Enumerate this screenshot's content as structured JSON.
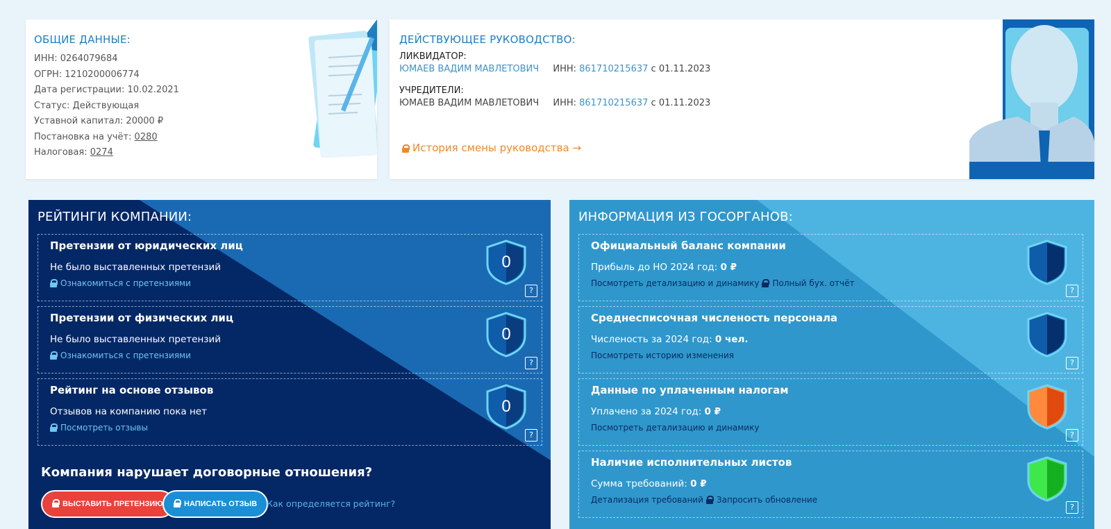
{
  "general": {
    "title": "ОБЩИЕ ДАННЫЕ:",
    "inn": "ИНН: 0264079684",
    "ogrn": "ОГРН: 1210200006774",
    "reg_date": "Дата регистрации: 10.02.2021",
    "status": "Статус:  Действующая",
    "capital": "Уставной капитал: 20000 ₽",
    "registration_label": "Постановка на учёт: ",
    "registration_value": "0280",
    "tax_label": "Налоговая: ",
    "tax_value": "0274"
  },
  "management": {
    "title": "ДЕЙСТВУЮЩЕЕ РУКОВОДСТВО:",
    "liquidator_role": "ЛИКВИДАТОР:",
    "liquidator_name": "ЮМАЕВ ВАДИМ МАВЛЕТОВИЧ",
    "liquidator_inn_label": "ИНН: ",
    "liquidator_inn": "861710215637",
    "liquidator_since": " с 01.11.2023",
    "founders_role": "УЧРЕДИТЕЛИ:",
    "founder_name": "ЮМАЕВ ВАДИМ МАВЛЕТОВИЧ",
    "founder_inn_label": "ИНН: ",
    "founder_inn": "861710215637",
    "founder_since": " с 01.11.2023",
    "history_link": "История смены руководства →"
  },
  "ratings": {
    "title": "РЕЙТИНГИ КОМПАНИИ:",
    "items": [
      {
        "title": "Претензии от юридических лиц",
        "text": "Не было выставленных претензий",
        "link": "Ознакомиться с претензиями",
        "score": "0"
      },
      {
        "title": "Претензии от физических лиц",
        "text": "Не было выставленных претензий",
        "link": "Ознакомиться с претензиями",
        "score": "0"
      },
      {
        "title": "Рейтинг на основе отзывов",
        "text": "Отзывов на компанию пока нет",
        "link": "Посмотреть отзывы",
        "score": "0"
      }
    ],
    "help": "?",
    "violation_question": "Компания нарушает договорные отношения?",
    "claim_button": "ВЫСТАВИТЬ ПРЕТЕНЗИЮ",
    "review_button": "НАПИСАТЬ ОТЗЫВ",
    "how_link": "Как определяется рейтинг?"
  },
  "gov": {
    "title": "ИНФОРМАЦИЯ ИЗ ГОСОРГАНОВ:",
    "items": [
      {
        "title": "Официальный баланс компании",
        "text_label": "Прибыль до НО 2024 год: ",
        "text_value": "0 ₽",
        "link1": "Посмотреть детализацию и динамику",
        "link2": "Полный бух. отчёт",
        "shield_color": "#0a4a94"
      },
      {
        "title": "Среднесписочная численость персонала",
        "text_label": "Численость за 2024 год: ",
        "text_value": "0 чел.",
        "link1": "Посмотреть историю изменения",
        "link2": "",
        "shield_color": "#0a4a94"
      },
      {
        "title": "Данные по уплаченным налогам",
        "text_label": "Уплачено за 2024 год: ",
        "text_value": "0 ₽",
        "link1": "Посмотреть детализацию и динамику",
        "link2": "",
        "shield_color": "#f26b1f"
      },
      {
        "title": "Наличие исполнительных листов",
        "text_label": "Сумма требований: ",
        "text_value": "0 ₽",
        "link1": "Детализация требований",
        "link2": "Запросить обновление",
        "shield_color": "#2fcc3c"
      }
    ]
  },
  "colors": {
    "accent_blue": "#1e7fc2",
    "orange": "#f0882a",
    "claim_red": "#e8423a",
    "review_blue": "#1a8fd6"
  }
}
